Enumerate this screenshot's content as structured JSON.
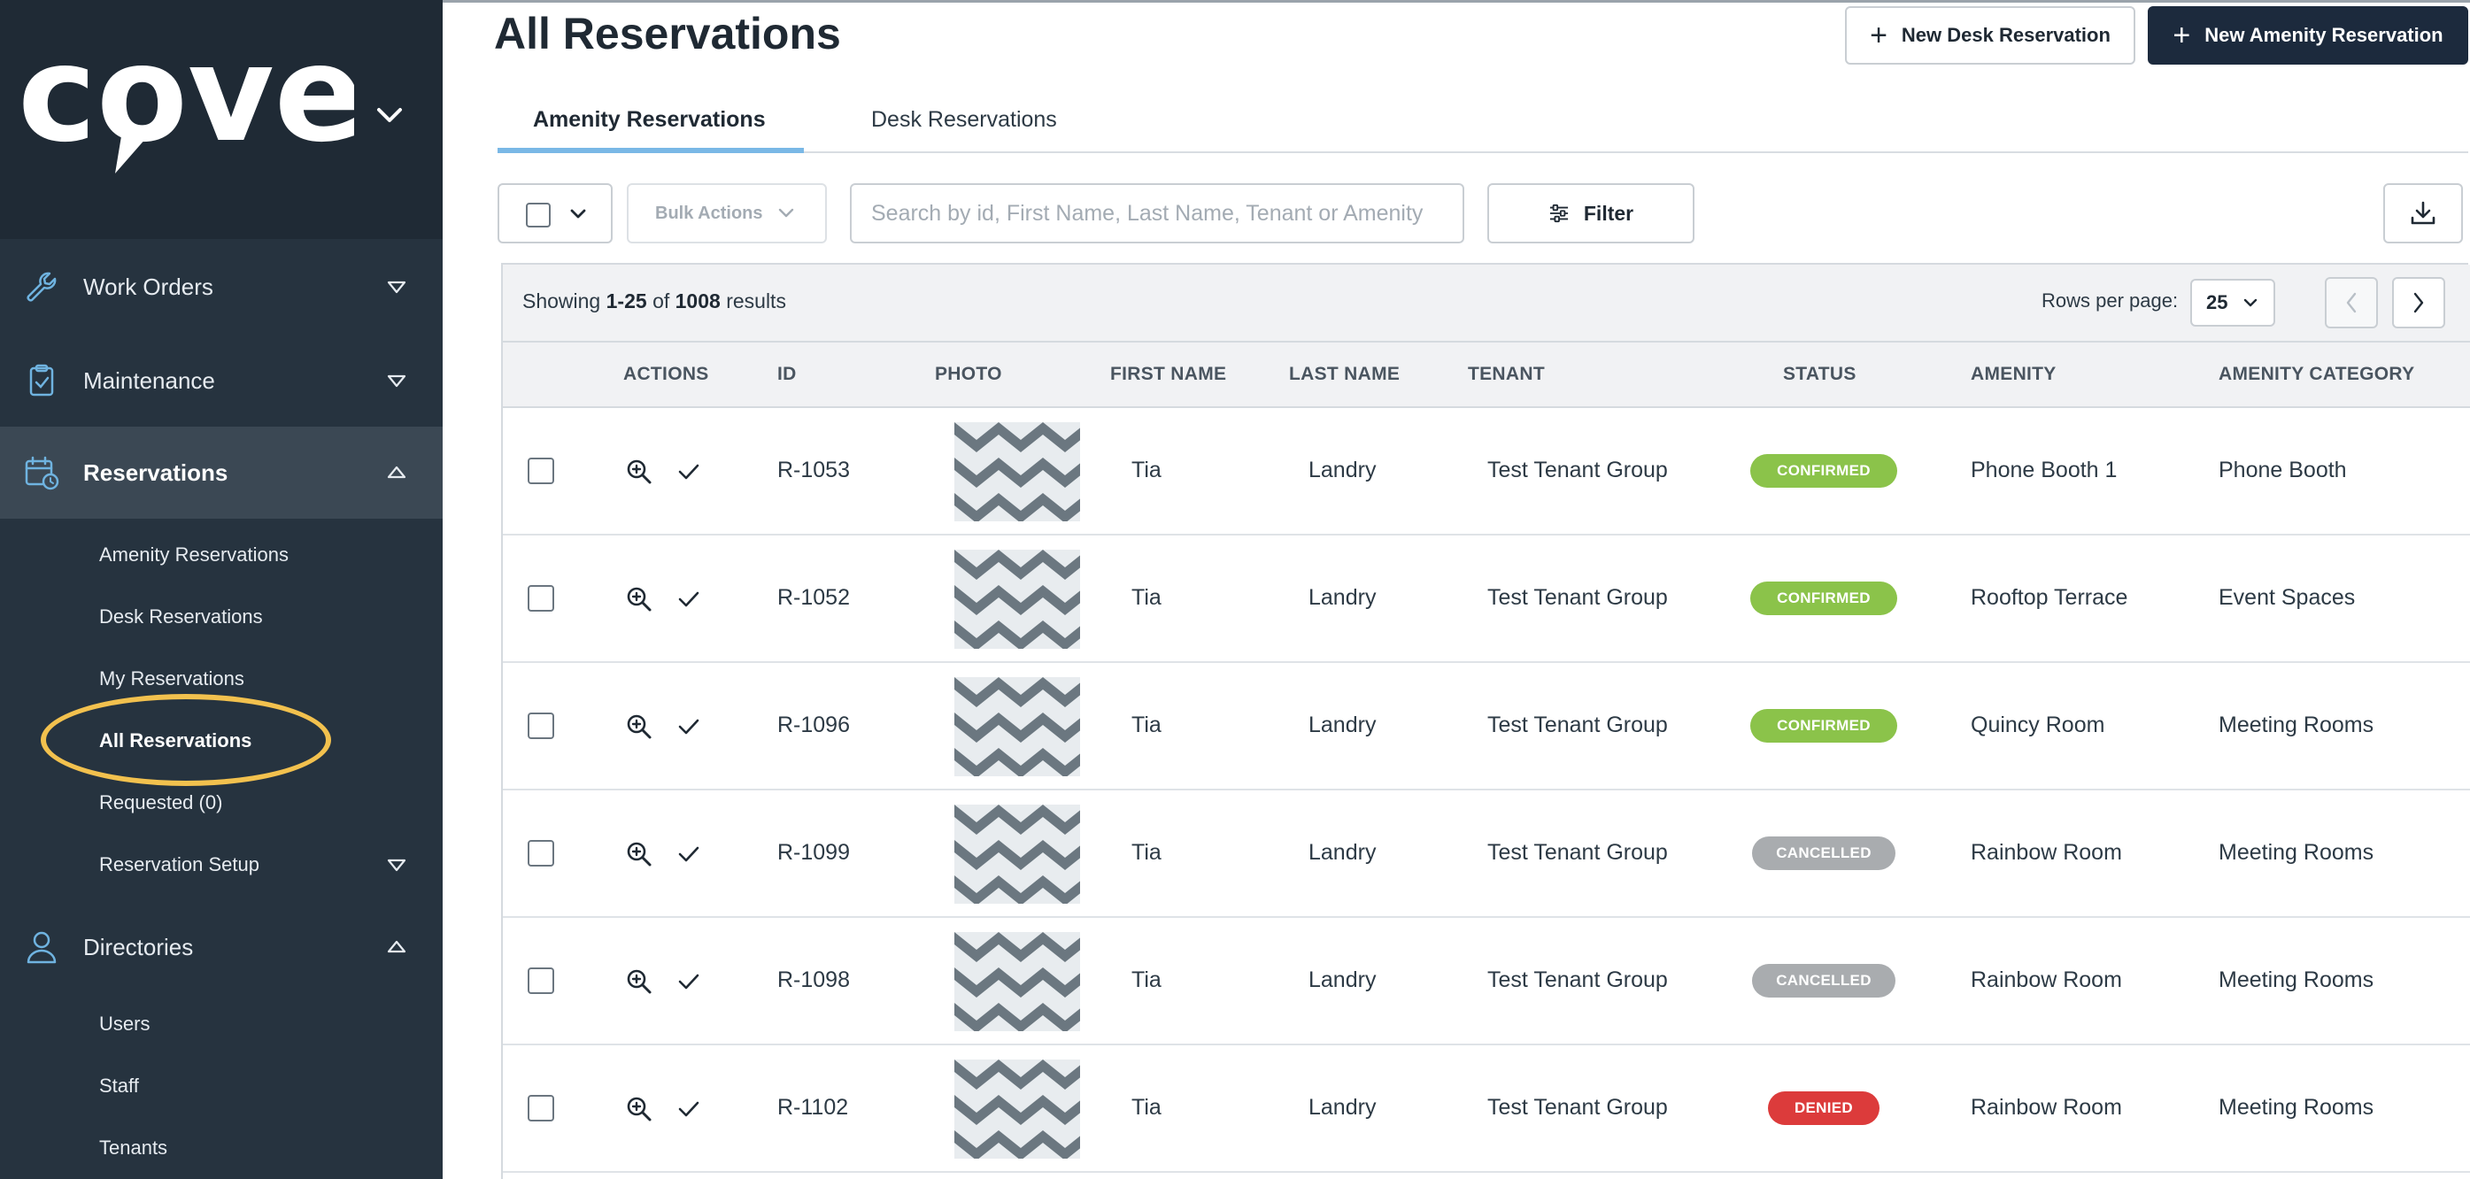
{
  "brand": {
    "logo_text": "cove"
  },
  "sidebar": {
    "sections": [
      {
        "label": "Work Orders"
      },
      {
        "label": "Maintenance"
      },
      {
        "label": "Reservations"
      },
      {
        "label": "Directories"
      }
    ],
    "reservation_items": [
      {
        "label": "Amenity Reservations"
      },
      {
        "label": "Desk Reservations"
      },
      {
        "label": "My Reservations"
      },
      {
        "label": "All Reservations"
      },
      {
        "label": "Requested (0)"
      },
      {
        "label": "Reservation Setup"
      }
    ],
    "directory_items": [
      {
        "label": "Users"
      },
      {
        "label": "Staff"
      },
      {
        "label": "Tenants"
      }
    ],
    "highlight_color": "#f2c14e"
  },
  "header": {
    "title": "All Reservations",
    "new_desk_label": "New Desk Reservation",
    "new_amenity_label": "New Amenity Reservation"
  },
  "tabs": [
    {
      "label": "Amenity Reservations",
      "active": true
    },
    {
      "label": "Desk Reservations",
      "active": false
    }
  ],
  "toolbar": {
    "bulk_actions_label": "Bulk Actions",
    "search_placeholder": "Search by id, First Name, Last Name, Tenant or Amenity",
    "search_value": "",
    "filter_label": "Filter"
  },
  "summary": {
    "showing_label": "Showing",
    "range": "1-25",
    "of_label": "of",
    "total": "1008",
    "results_label": "results",
    "rows_per_page_label": "Rows per page:",
    "rows_per_page": "25"
  },
  "table": {
    "columns": [
      "ACTIONS",
      "ID",
      "PHOTO",
      "FIRST NAME",
      "LAST NAME",
      "TENANT",
      "STATUS",
      "AMENITY",
      "AMENITY CATEGORY"
    ],
    "rows": [
      {
        "id": "R-1053",
        "first": "Tia",
        "last": "Landry",
        "tenant": "Test Tenant Group",
        "status": "CONFIRMED",
        "amenity": "Phone Booth 1",
        "category": "Phone Booth"
      },
      {
        "id": "R-1052",
        "first": "Tia",
        "last": "Landry",
        "tenant": "Test Tenant Group",
        "status": "CONFIRMED",
        "amenity": "Rooftop Terrace",
        "category": "Event Spaces"
      },
      {
        "id": "R-1096",
        "first": "Tia",
        "last": "Landry",
        "tenant": "Test Tenant Group",
        "status": "CONFIRMED",
        "amenity": "Quincy Room",
        "category": "Meeting Rooms"
      },
      {
        "id": "R-1099",
        "first": "Tia",
        "last": "Landry",
        "tenant": "Test Tenant Group",
        "status": "CANCELLED",
        "amenity": "Rainbow Room",
        "category": "Meeting Rooms"
      },
      {
        "id": "R-1098",
        "first": "Tia",
        "last": "Landry",
        "tenant": "Test Tenant Group",
        "status": "CANCELLED",
        "amenity": "Rainbow Room",
        "category": "Meeting Rooms"
      },
      {
        "id": "R-1102",
        "first": "Tia",
        "last": "Landry",
        "tenant": "Test Tenant Group",
        "status": "DENIED",
        "amenity": "Rainbow Room",
        "category": "Meeting Rooms"
      }
    ]
  },
  "status_colors": {
    "CONFIRMED": "#8bc34a",
    "CANCELLED": "#a9acaf",
    "DENIED": "#dc3b3b"
  },
  "icons": {
    "work_orders": "wrench-icon",
    "maintenance": "clipboard-check-icon",
    "reservations": "calendar-clock-icon",
    "directories": "user-icon",
    "filter": "sliders-icon",
    "download": "download-icon",
    "row_view": "zoom-in-icon",
    "row_confirm": "check-icon"
  }
}
